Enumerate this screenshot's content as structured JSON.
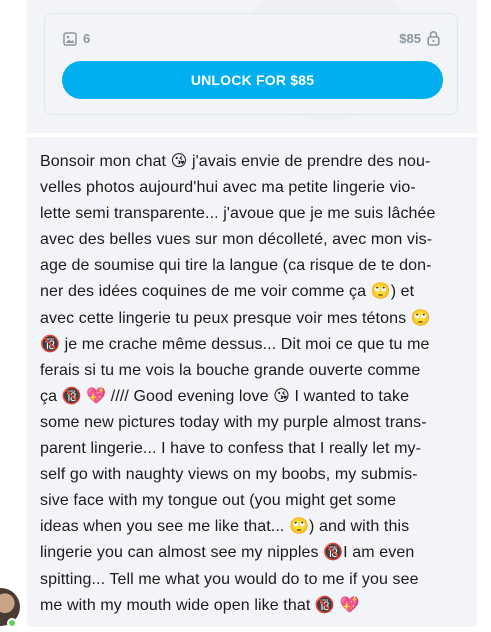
{
  "locked_post": {
    "media_count": "6",
    "price": "$85",
    "unlock_label": "UNLOCK FOR $85",
    "icons": {
      "media": "image-icon",
      "lock": "lock-icon"
    }
  },
  "message": {
    "text": "Bonsoir mon chat 😘 j'avais envie de prendre des nou-\nvelles photos aujourd'hui avec ma petite lingerie vio-\nlette semi transparente... j'avoue que je me suis lâchée\navec des belles vues sur mon décolleté, avec mon vis-\nage de soumise qui tire la langue (ca risque de te don-\nner des idées coquines de me voir comme ça 🙄) et\navec cette lingerie tu peux presque voir mes tétons 🙄\n🔞 je me crache même dessus... Dit moi ce que tu me\nferais si tu me vois la bouche grande ouverte comme\nça 🔞 💖 //// Good evening love 😘 I wanted to take\nsome new pictures today with my purple almost trans-\nparent lingerie... I have to confess that I really let my-\nself go with naughty views on my boobs, my submis-\nsive face with my tongue out (you might get some\nideas when you see me like that... 🙄) and with this\nlingerie you can almost see my nipples 🔞I am even\nspitting... Tell me what you would do to me if you see\nme with my mouth wide open like that 🔞 💖"
  },
  "sender": {
    "status": "online"
  },
  "colors": {
    "accent": "#00aff0",
    "online": "#5fd35f",
    "muted": "#8a96a3"
  }
}
